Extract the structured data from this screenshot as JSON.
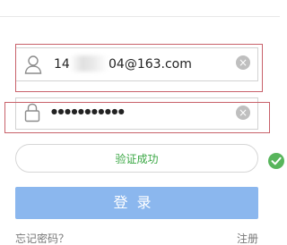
{
  "email_field": {
    "value_prefix": "14",
    "value_suffix": "04@163.com",
    "clear_icon": "clear-x-icon"
  },
  "password_field": {
    "value": "●●●●●●●●●●●",
    "clear_icon": "clear-x-icon"
  },
  "captcha": {
    "status": "验证成功",
    "status_color": "#3aa744",
    "icon": "check-circle-icon"
  },
  "login_button": {
    "label": "登录",
    "color": "#8bb7ee"
  },
  "footer": {
    "forgot_password": "忘记密码？",
    "register": "注册"
  }
}
